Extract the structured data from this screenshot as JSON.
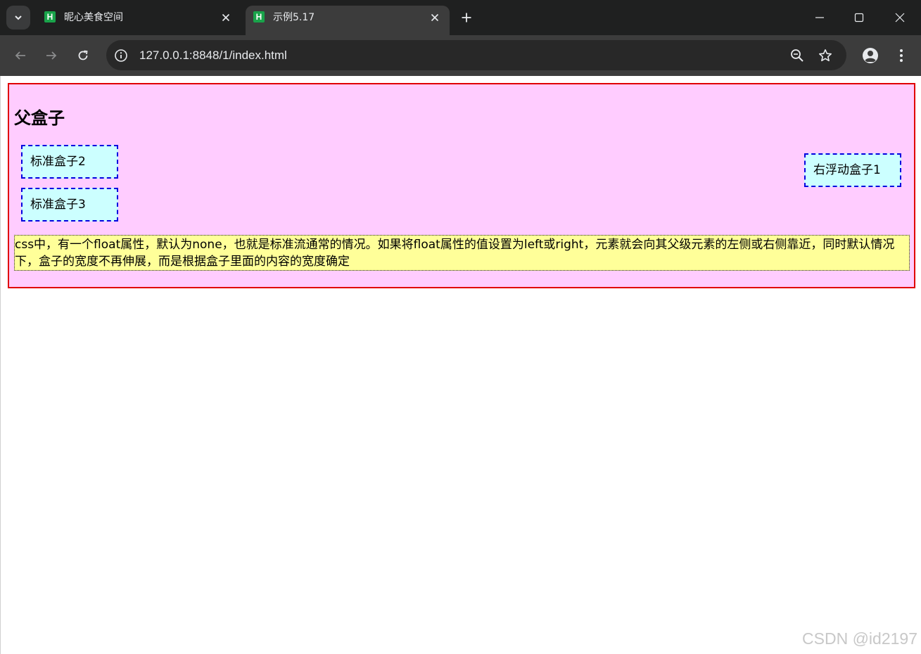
{
  "browser": {
    "tabs": [
      {
        "title": "昵心美食空间",
        "favicon_letter": "H",
        "active": false
      },
      {
        "title": "示例5.17",
        "favicon_letter": "H",
        "active": true
      }
    ],
    "url": "127.0.0.1:8848/1/index.html",
    "icons": {
      "tab_search": "chevron-down-icon",
      "tab_close": "close-icon",
      "new_tab": "plus-icon",
      "minimize": "minimize-icon",
      "maximize": "maximize-icon",
      "window_close": "close-icon",
      "back": "back-arrow-icon",
      "forward": "forward-arrow-icon",
      "reload": "reload-icon",
      "site_info": "info-icon",
      "zoom": "zoom-out-icon",
      "bookmark": "star-icon",
      "profile": "profile-icon",
      "menu": "kebab-menu-icon"
    }
  },
  "page": {
    "heading": "父盒子",
    "boxes": {
      "standard_2": "标准盒子2",
      "standard_3": "标准盒子3",
      "float_right_1": "右浮动盒子1"
    },
    "paragraph": "css中，有一个float属性，默认为none，也就是标准流通常的情况。如果将float属性的值设置为left或right，元素就会向其父级元素的左侧或右侧靠近，同时默认情况下，盒子的宽度不再伸展，而是根据盒子里面的内容的宽度确定"
  },
  "watermark": "CSDN @id2197",
  "colors": {
    "parent_bg": "#ffccff",
    "parent_border": "#e00000",
    "box_bg": "#ccffff",
    "box_border": "#0000e0",
    "para_bg": "#ffff99"
  }
}
